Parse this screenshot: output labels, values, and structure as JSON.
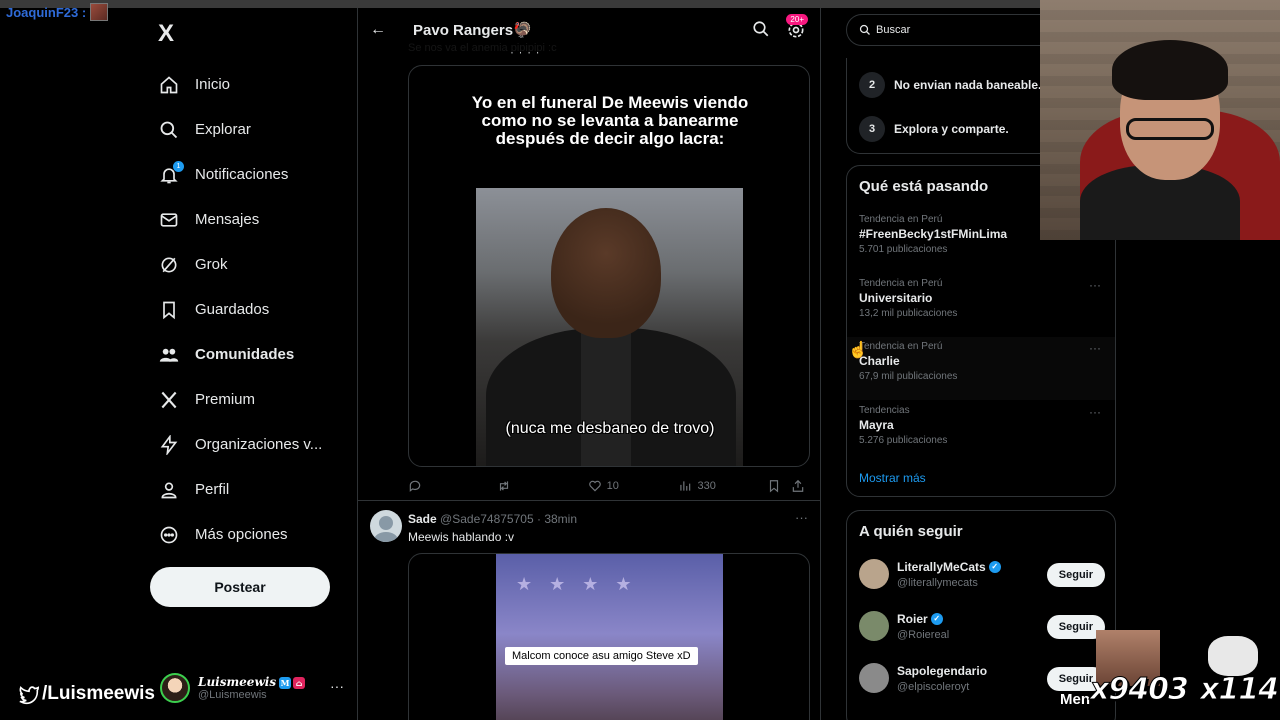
{
  "stream": {
    "chat_user": "JoaquinF23 :",
    "twitter_handle": "/Luismeewis",
    "counter_left": "x9403",
    "counter_right": "x114",
    "menc_text": "Men"
  },
  "sidebar": {
    "logo": "X",
    "items": [
      {
        "label": "Inicio",
        "icon": "home-icon"
      },
      {
        "label": "Explorar",
        "icon": "search-icon"
      },
      {
        "label": "Notificaciones",
        "icon": "bell-icon",
        "badge": "1"
      },
      {
        "label": "Mensajes",
        "icon": "mail-icon"
      },
      {
        "label": "Grok",
        "icon": "grok-icon"
      },
      {
        "label": "Guardados",
        "icon": "bookmark-icon"
      },
      {
        "label": "Comunidades",
        "icon": "communities-icon",
        "active": true
      },
      {
        "label": "Premium",
        "icon": "x-logo-icon"
      },
      {
        "label": "Organizaciones v...",
        "icon": "lightning-icon"
      },
      {
        "label": "Perfil",
        "icon": "person-icon"
      },
      {
        "label": "Más opciones",
        "icon": "more-circle-icon"
      }
    ],
    "post_label": "Postear",
    "account": {
      "name": "Luismeewis",
      "handle": "@Luismeewis",
      "badge_m": "M",
      "badge_r": "⌂"
    }
  },
  "center": {
    "title": "Pavo Rangers🦃",
    "notif_badge": "20+",
    "prev_text": "Se nos va el anemia pipipipi :c",
    "meme": {
      "caption": "Yo en el funeral De Meewis viendo como no se levanta a banearme después de decir algo lacra:",
      "subtitle": "(nuca me desbaneo de trovo)"
    },
    "actions": {
      "likes": "10",
      "views": "330"
    },
    "tweet2": {
      "name": "Sade",
      "handle": "@Sade74875705",
      "time": "· 38min",
      "text": "Meewis hablando :v",
      "video_subtitle": "Malcom conoce asu amigo Steve xD"
    }
  },
  "right": {
    "search_placeholder": "Buscar",
    "rules": [
      {
        "num": "2",
        "text": "No envian nada baneable."
      },
      {
        "num": "3",
        "text": "Explora y comparte."
      }
    ],
    "trends_title": "Qué está pasando",
    "trends": [
      {
        "category": "Tendencia en Perú",
        "name": "#FreenBecky1stFMinLima",
        "count": "5.701 publicaciones"
      },
      {
        "category": "Tendencia en Perú",
        "name": "Universitario",
        "count": "13,2 mil publicaciones"
      },
      {
        "category": "Tendencia en Perú",
        "name": "Charlie",
        "count": "67,9 mil publicaciones"
      },
      {
        "category": "Tendencias",
        "name": "Mayra",
        "count": "5.276 publicaciones"
      }
    ],
    "show_more": "Mostrar más",
    "follow_title": "A quién seguir",
    "follow": [
      {
        "name": "LiterallyMeCats",
        "handle": "@literallymecats",
        "button": "Seguir",
        "color": "#b9a48c"
      },
      {
        "name": "Roier",
        "handle": "@Roiereal",
        "button": "Seguir",
        "color": "#7a8a6a"
      },
      {
        "name": "Sapolegendario",
        "handle": "@elpiscoleroyt",
        "button": "Seguir",
        "color": "#8a8a8a"
      }
    ]
  }
}
